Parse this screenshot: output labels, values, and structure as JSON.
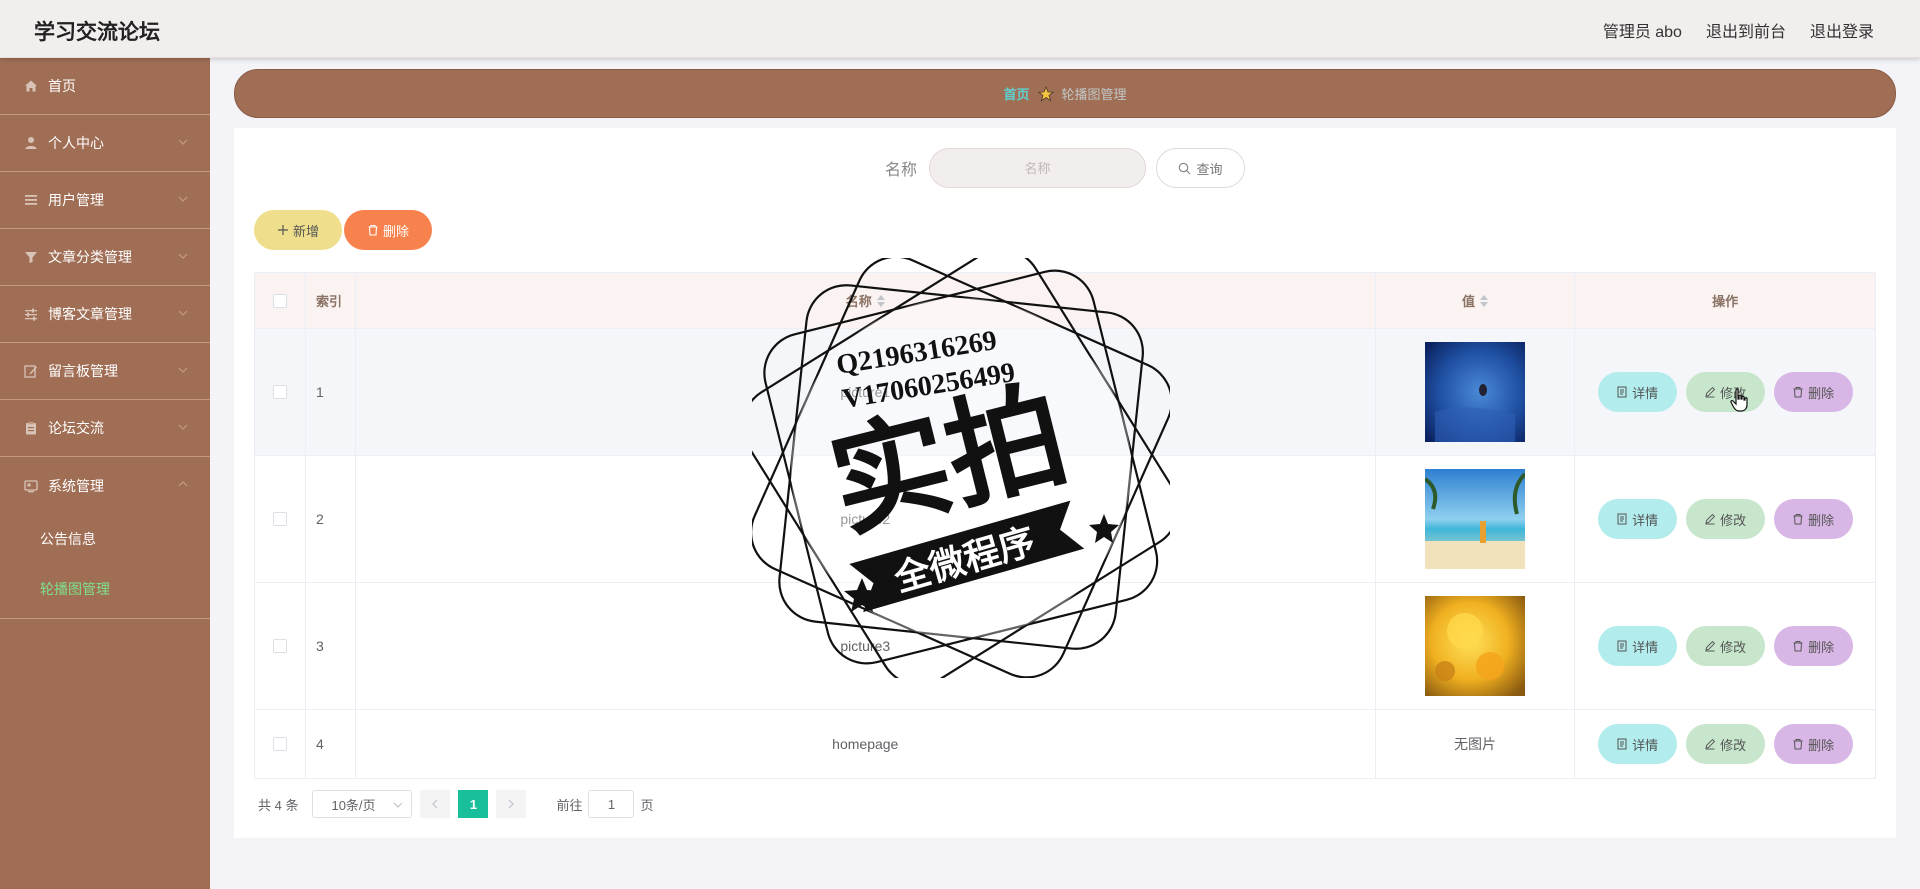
{
  "header": {
    "title": "学习交流论坛",
    "user": "管理员 abo",
    "to_front": "退出到前台",
    "logout": "退出登录"
  },
  "sidebar": {
    "items": [
      {
        "label": "首页",
        "icon": "home-icon"
      },
      {
        "label": "个人中心",
        "icon": "user-icon"
      },
      {
        "label": "用户管理",
        "icon": "list-icon"
      },
      {
        "label": "文章分类管理",
        "icon": "funnel-icon"
      },
      {
        "label": "博客文章管理",
        "icon": "sliders-icon"
      },
      {
        "label": "留言板管理",
        "icon": "edit-icon"
      },
      {
        "label": "论坛交流",
        "icon": "clipboard-icon"
      },
      {
        "label": "系统管理",
        "icon": "monitor-icon"
      }
    ],
    "sub_items": [
      {
        "label": "公告信息",
        "active": false
      },
      {
        "label": "轮播图管理",
        "active": true
      }
    ]
  },
  "breadcrumb": {
    "home": "首页",
    "current": "轮播图管理"
  },
  "search": {
    "label": "名称",
    "placeholder": "名称",
    "button": "查询"
  },
  "actions": {
    "add": "新增",
    "delete": "删除"
  },
  "table": {
    "columns": {
      "index": "索引",
      "name": "名称",
      "value": "值",
      "ops": "操作"
    },
    "rows": [
      {
        "index": "1",
        "name": "picture1",
        "value": ""
      },
      {
        "index": "2",
        "name": "picture2",
        "value": ""
      },
      {
        "index": "3",
        "name": "picture3",
        "value": ""
      },
      {
        "index": "4",
        "name": "homepage",
        "value": "无图片"
      }
    ],
    "op_labels": {
      "detail": "详情",
      "edit": "修改",
      "remove": "删除"
    }
  },
  "pagination": {
    "total": "共 4 条",
    "page_size": "10条/页",
    "current_page": "1",
    "goto_prefix": "前往",
    "goto_value": "1",
    "goto_suffix": "页"
  },
  "watermark": {
    "line1": "Q2196316269",
    "line2": "V17060256499",
    "main": "实拍",
    "banner": "全微程序"
  },
  "colors": {
    "sidebar": "#a06e55",
    "accent_green": "#19be9a",
    "btn_add": "#efdf8c",
    "btn_delete": "#f7824d"
  }
}
